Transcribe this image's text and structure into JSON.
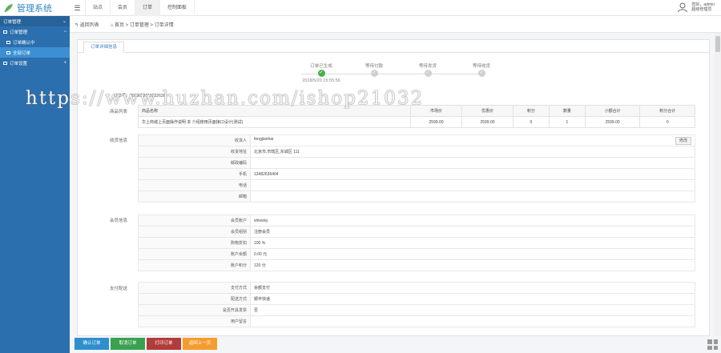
{
  "app": {
    "title": "管理系统"
  },
  "topnav": [
    "站点",
    "会员",
    "订单",
    "控制面板"
  ],
  "user": {
    "line1": "您好，admin",
    "line2": "超级管理员"
  },
  "sidebar": {
    "group1": {
      "label": "订单管理",
      "toggle": "⌄"
    },
    "group2": {
      "label": "订单管理",
      "toggle": "−"
    },
    "items": [
      "订单确认中",
      "全部订单"
    ],
    "group3": {
      "label": "订单设置",
      "toggle": "+"
    }
  },
  "breadcrumb": {
    "back": "返回列表",
    "path": "首页 > 订单管理 > 订单详情"
  },
  "tab": "订单详细信息",
  "steps": [
    {
      "label": "订单已生成",
      "done": true,
      "time": "2018/5/20 15:55:56"
    },
    {
      "label": "等待付款",
      "done": false,
      "time": ""
    },
    {
      "label": "等待发货",
      "done": false,
      "time": ""
    },
    {
      "label": "等待收货",
      "done": false,
      "time": ""
    }
  ],
  "order_no": "订单号：2018052015552638",
  "watermark": "https://www.huzhan.com/ishop21032",
  "sections": {
    "products": "商品列表",
    "shipping": "收货信息",
    "member": "会员信息",
    "payment": "支付配送"
  },
  "product_table": {
    "headers": [
      "商品名称",
      "市场价",
      "优惠价",
      "积分",
      "数量",
      "小额合计",
      "积分合计"
    ],
    "rows": [
      [
        "华上商城上页面操作说明 本 介绍使用页面接口设计(测试)",
        "2599.00",
        "2599.00",
        "0",
        "1",
        "2599.00",
        "0"
      ]
    ]
  },
  "shipping": {
    "rows": [
      {
        "k": "收货人",
        "v": "fengjianhai"
      },
      {
        "k": "收货地址",
        "v": "北京市,市辖区,东城区 111"
      },
      {
        "k": "邮政编码",
        "v": ""
      },
      {
        "k": "手机",
        "v": "13482636404"
      },
      {
        "k": "电话",
        "v": ""
      },
      {
        "k": "邮箱",
        "v": ""
      }
    ],
    "edit": "修改"
  },
  "member": {
    "rows": [
      {
        "k": "会员账户",
        "v": "shiwsky"
      },
      {
        "k": "会员组别",
        "v": "注册会员"
      },
      {
        "k": "购物折扣",
        "v": "100 %"
      },
      {
        "k": "账户余额",
        "v": "0.00 元"
      },
      {
        "k": "账户积分",
        "v": "120 分"
      }
    ]
  },
  "payment": {
    "rows": [
      {
        "k": "支付方式",
        "v": "余额支付"
      },
      {
        "k": "配送方式",
        "v": "顺丰快递"
      },
      {
        "k": "是否开具发票",
        "v": "否"
      },
      {
        "k": "用户留言",
        "v": ""
      }
    ]
  },
  "actions": [
    "确认订单",
    "取消订单",
    "打印订单",
    "返回上一页"
  ]
}
